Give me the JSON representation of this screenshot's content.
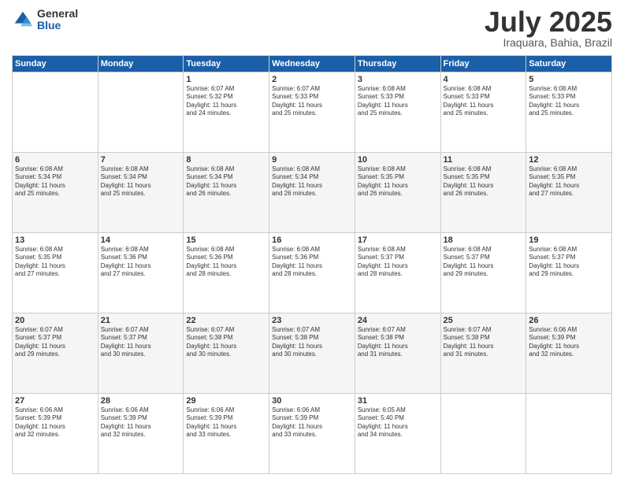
{
  "header": {
    "logo_general": "General",
    "logo_blue": "Blue",
    "month_title": "July 2025",
    "subtitle": "Iraquara, Bahia, Brazil"
  },
  "weekdays": [
    "Sunday",
    "Monday",
    "Tuesday",
    "Wednesday",
    "Thursday",
    "Friday",
    "Saturday"
  ],
  "weeks": [
    [
      {
        "day": "",
        "info": ""
      },
      {
        "day": "",
        "info": ""
      },
      {
        "day": "1",
        "info": "Sunrise: 6:07 AM\nSunset: 5:32 PM\nDaylight: 11 hours\nand 24 minutes."
      },
      {
        "day": "2",
        "info": "Sunrise: 6:07 AM\nSunset: 5:33 PM\nDaylight: 11 hours\nand 25 minutes."
      },
      {
        "day": "3",
        "info": "Sunrise: 6:08 AM\nSunset: 5:33 PM\nDaylight: 11 hours\nand 25 minutes."
      },
      {
        "day": "4",
        "info": "Sunrise: 6:08 AM\nSunset: 5:33 PM\nDaylight: 11 hours\nand 25 minutes."
      },
      {
        "day": "5",
        "info": "Sunrise: 6:08 AM\nSunset: 5:33 PM\nDaylight: 11 hours\nand 25 minutes."
      }
    ],
    [
      {
        "day": "6",
        "info": "Sunrise: 6:08 AM\nSunset: 5:34 PM\nDaylight: 11 hours\nand 25 minutes."
      },
      {
        "day": "7",
        "info": "Sunrise: 6:08 AM\nSunset: 5:34 PM\nDaylight: 11 hours\nand 25 minutes."
      },
      {
        "day": "8",
        "info": "Sunrise: 6:08 AM\nSunset: 5:34 PM\nDaylight: 11 hours\nand 26 minutes."
      },
      {
        "day": "9",
        "info": "Sunrise: 6:08 AM\nSunset: 5:34 PM\nDaylight: 11 hours\nand 26 minutes."
      },
      {
        "day": "10",
        "info": "Sunrise: 6:08 AM\nSunset: 5:35 PM\nDaylight: 11 hours\nand 26 minutes."
      },
      {
        "day": "11",
        "info": "Sunrise: 6:08 AM\nSunset: 5:35 PM\nDaylight: 11 hours\nand 26 minutes."
      },
      {
        "day": "12",
        "info": "Sunrise: 6:08 AM\nSunset: 5:35 PM\nDaylight: 11 hours\nand 27 minutes."
      }
    ],
    [
      {
        "day": "13",
        "info": "Sunrise: 6:08 AM\nSunset: 5:35 PM\nDaylight: 11 hours\nand 27 minutes."
      },
      {
        "day": "14",
        "info": "Sunrise: 6:08 AM\nSunset: 5:36 PM\nDaylight: 11 hours\nand 27 minutes."
      },
      {
        "day": "15",
        "info": "Sunrise: 6:08 AM\nSunset: 5:36 PM\nDaylight: 11 hours\nand 28 minutes."
      },
      {
        "day": "16",
        "info": "Sunrise: 6:08 AM\nSunset: 5:36 PM\nDaylight: 11 hours\nand 28 minutes."
      },
      {
        "day": "17",
        "info": "Sunrise: 6:08 AM\nSunset: 5:37 PM\nDaylight: 11 hours\nand 28 minutes."
      },
      {
        "day": "18",
        "info": "Sunrise: 6:08 AM\nSunset: 5:37 PM\nDaylight: 11 hours\nand 29 minutes."
      },
      {
        "day": "19",
        "info": "Sunrise: 6:08 AM\nSunset: 5:37 PM\nDaylight: 11 hours\nand 29 minutes."
      }
    ],
    [
      {
        "day": "20",
        "info": "Sunrise: 6:07 AM\nSunset: 5:37 PM\nDaylight: 11 hours\nand 29 minutes."
      },
      {
        "day": "21",
        "info": "Sunrise: 6:07 AM\nSunset: 5:37 PM\nDaylight: 11 hours\nand 30 minutes."
      },
      {
        "day": "22",
        "info": "Sunrise: 6:07 AM\nSunset: 5:38 PM\nDaylight: 11 hours\nand 30 minutes."
      },
      {
        "day": "23",
        "info": "Sunrise: 6:07 AM\nSunset: 5:38 PM\nDaylight: 11 hours\nand 30 minutes."
      },
      {
        "day": "24",
        "info": "Sunrise: 6:07 AM\nSunset: 5:38 PM\nDaylight: 11 hours\nand 31 minutes."
      },
      {
        "day": "25",
        "info": "Sunrise: 6:07 AM\nSunset: 5:38 PM\nDaylight: 11 hours\nand 31 minutes."
      },
      {
        "day": "26",
        "info": "Sunrise: 6:06 AM\nSunset: 5:39 PM\nDaylight: 11 hours\nand 32 minutes."
      }
    ],
    [
      {
        "day": "27",
        "info": "Sunrise: 6:06 AM\nSunset: 5:39 PM\nDaylight: 11 hours\nand 32 minutes."
      },
      {
        "day": "28",
        "info": "Sunrise: 6:06 AM\nSunset: 5:39 PM\nDaylight: 11 hours\nand 32 minutes."
      },
      {
        "day": "29",
        "info": "Sunrise: 6:06 AM\nSunset: 5:39 PM\nDaylight: 11 hours\nand 33 minutes."
      },
      {
        "day": "30",
        "info": "Sunrise: 6:06 AM\nSunset: 5:39 PM\nDaylight: 11 hours\nand 33 minutes."
      },
      {
        "day": "31",
        "info": "Sunrise: 6:05 AM\nSunset: 5:40 PM\nDaylight: 11 hours\nand 34 minutes."
      },
      {
        "day": "",
        "info": ""
      },
      {
        "day": "",
        "info": ""
      }
    ]
  ]
}
